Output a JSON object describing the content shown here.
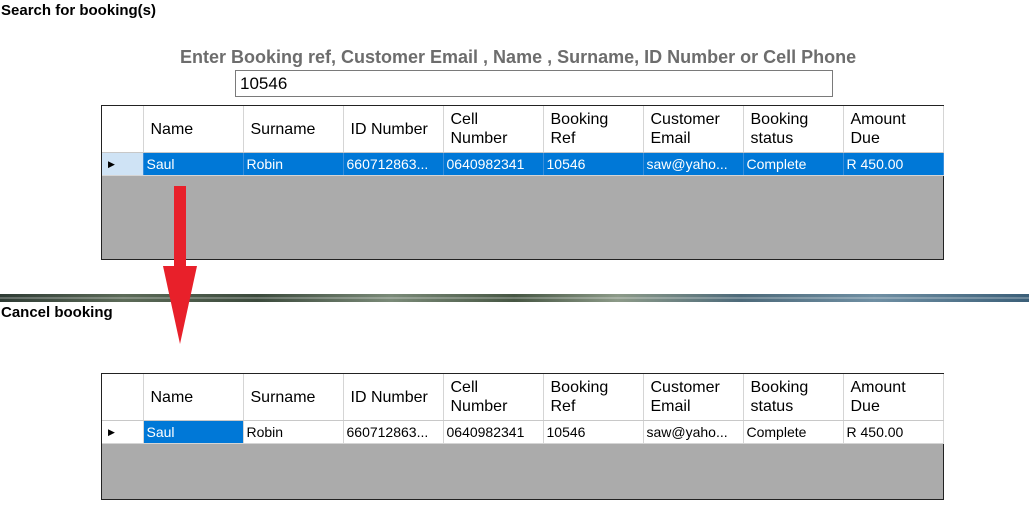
{
  "search_section": {
    "title": "Search for booking(s)",
    "prompt": "Enter Booking ref, Customer Email , Name , Surname, ID Number or Cell Phone",
    "input_value": "10546"
  },
  "cancel_section": {
    "title": "Cancel booking"
  },
  "columns": {
    "name": "Name",
    "surname": "Surname",
    "id_number": "ID Number",
    "cell_number": "Cell Number",
    "booking_ref": "Booking Ref",
    "customer_email": "Customer Email",
    "booking_status": "Booking status",
    "amount_due": "Amount Due"
  },
  "search_row": {
    "name": "Saul",
    "surname": "Robin",
    "id_number": "660712863...",
    "cell_number": "0640982341",
    "booking_ref": "10546",
    "customer_email": "saw@yaho...",
    "booking_status": "Complete",
    "amount_due": "R 450.00"
  },
  "cancel_row": {
    "name": "Saul",
    "surname": "Robin",
    "id_number": "660712863...",
    "cell_number": "0640982341",
    "booking_ref": "10546",
    "customer_email": "saw@yaho...",
    "booking_status": "Complete",
    "amount_due": "R 450.00"
  },
  "row_indicator_icon": "triangle-right-icon",
  "annotation_icon": "red-down-arrow-icon",
  "colors": {
    "selection": "#0078d7",
    "grid_background": "#ababab",
    "prompt_text": "#6d6d6d",
    "arrow": "#e8202a"
  }
}
